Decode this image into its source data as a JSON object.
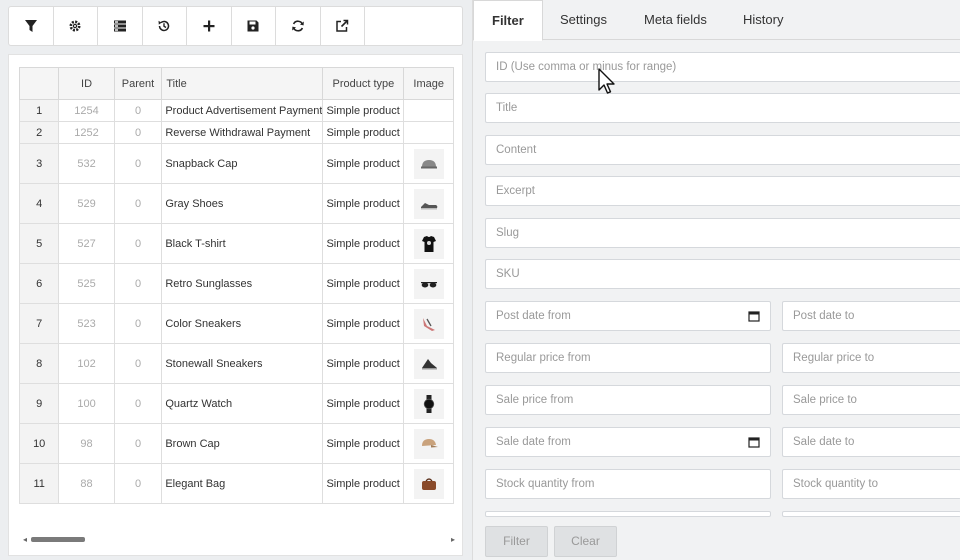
{
  "toolbar": {
    "buttons": [
      {
        "icon": "filter-icon"
      },
      {
        "icon": "gear-icon"
      },
      {
        "icon": "columns-icon"
      },
      {
        "icon": "history-icon"
      },
      {
        "icon": "plus-icon"
      },
      {
        "icon": "save-icon"
      },
      {
        "icon": "refresh-icon"
      },
      {
        "icon": "export-icon"
      }
    ]
  },
  "grid": {
    "columns": [
      "",
      "ID",
      "Parent",
      "Title",
      "Product type",
      "Image"
    ],
    "rows": [
      {
        "num": "1",
        "id": "1254",
        "parent": "0",
        "title": "Product Advertisement Payment",
        "type": "Simple product",
        "image": ""
      },
      {
        "num": "2",
        "id": "1252",
        "parent": "0",
        "title": "Reverse Withdrawal Payment",
        "type": "Simple product",
        "image": ""
      },
      {
        "num": "3",
        "id": "532",
        "parent": "0",
        "title": "Snapback Cap",
        "type": "Simple product",
        "image": "cap-icon"
      },
      {
        "num": "4",
        "id": "529",
        "parent": "0",
        "title": "Gray Shoes",
        "type": "Simple product",
        "image": "shoe-icon"
      },
      {
        "num": "5",
        "id": "527",
        "parent": "0",
        "title": "Black T-shirt",
        "type": "Simple product",
        "image": "tshirt-icon"
      },
      {
        "num": "6",
        "id": "525",
        "parent": "0",
        "title": "Retro Sunglasses",
        "type": "Simple product",
        "image": "sunglasses-icon"
      },
      {
        "num": "7",
        "id": "523",
        "parent": "0",
        "title": "Color Sneakers",
        "type": "Simple product",
        "image": "sneaker-icon"
      },
      {
        "num": "8",
        "id": "102",
        "parent": "0",
        "title": "Stonewall Sneakers",
        "type": "Simple product",
        "image": "sneaker-dark-icon"
      },
      {
        "num": "9",
        "id": "100",
        "parent": "0",
        "title": "Quartz Watch",
        "type": "Simple product",
        "image": "watch-icon"
      },
      {
        "num": "10",
        "id": "98",
        "parent": "0",
        "title": "Brown Cap",
        "type": "Simple product",
        "image": "cap-brown-icon"
      },
      {
        "num": "11",
        "id": "88",
        "parent": "0",
        "title": "Elegant Bag",
        "type": "Simple product",
        "image": "bag-icon"
      }
    ]
  },
  "tabs": [
    "Filter",
    "Settings",
    "Meta fields",
    "History"
  ],
  "filter": {
    "id_placeholder": "ID (Use comma or minus for range)",
    "title_placeholder": "Title",
    "content_placeholder": "Content",
    "excerpt_placeholder": "Excerpt",
    "slug_placeholder": "Slug",
    "sku_placeholder": "SKU",
    "post_date_from": "Post date from",
    "post_date_to": "Post date to",
    "regular_price_from": "Regular price from",
    "regular_price_to": "Regular price to",
    "sale_price_from": "Sale price from",
    "sale_price_to": "Sale price to",
    "sale_date_from": "Sale date from",
    "sale_date_to": "Sale date to",
    "stock_qty_from": "Stock quantity from",
    "stock_qty_to": "Stock quantity to",
    "filter_button": "Filter",
    "clear_button": "Clear"
  },
  "colors": {
    "accent": "#333333",
    "placeholder": "#999999",
    "button_bg": "#dfe1e3"
  }
}
